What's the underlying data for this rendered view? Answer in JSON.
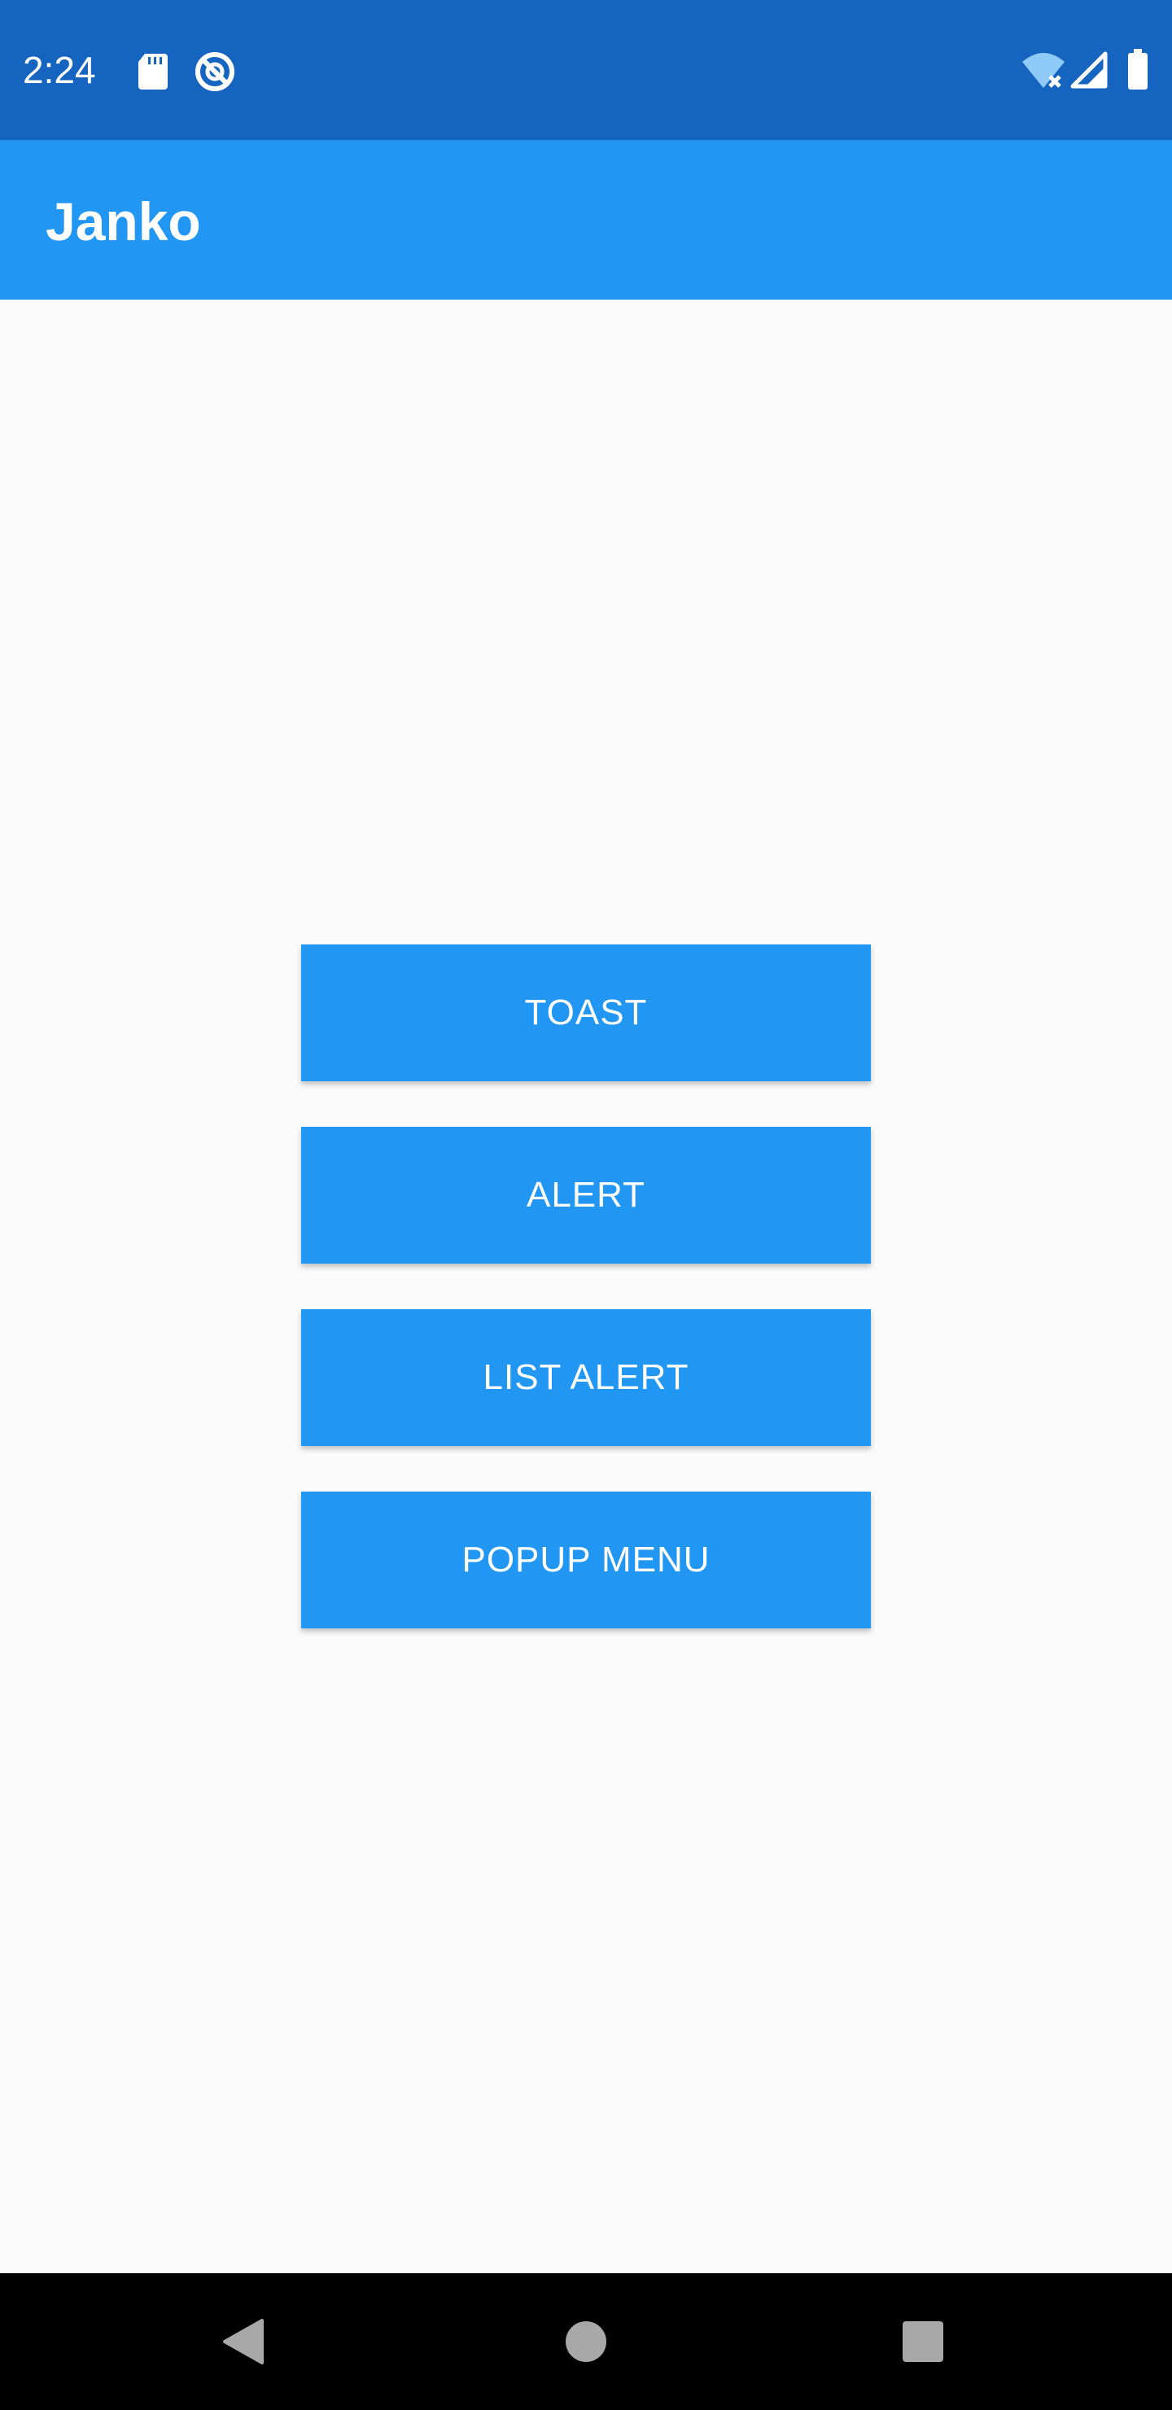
{
  "status_bar": {
    "time": "2:24",
    "icons": [
      "sd-card-icon",
      "do-not-disturb-icon",
      "wifi-off-icon",
      "cell-signal-icon",
      "battery-icon"
    ],
    "background_color": "#1565C0"
  },
  "app_bar": {
    "title": "Janko",
    "background_color": "#2196F3"
  },
  "buttons": [
    {
      "label": "TOAST"
    },
    {
      "label": "ALERT"
    },
    {
      "label": "LIST ALERT"
    },
    {
      "label": "POPUP MENU"
    }
  ],
  "button_color": "#2196F3",
  "nav_bar": {
    "icons": [
      "back-icon",
      "home-icon",
      "recents-icon"
    ]
  }
}
